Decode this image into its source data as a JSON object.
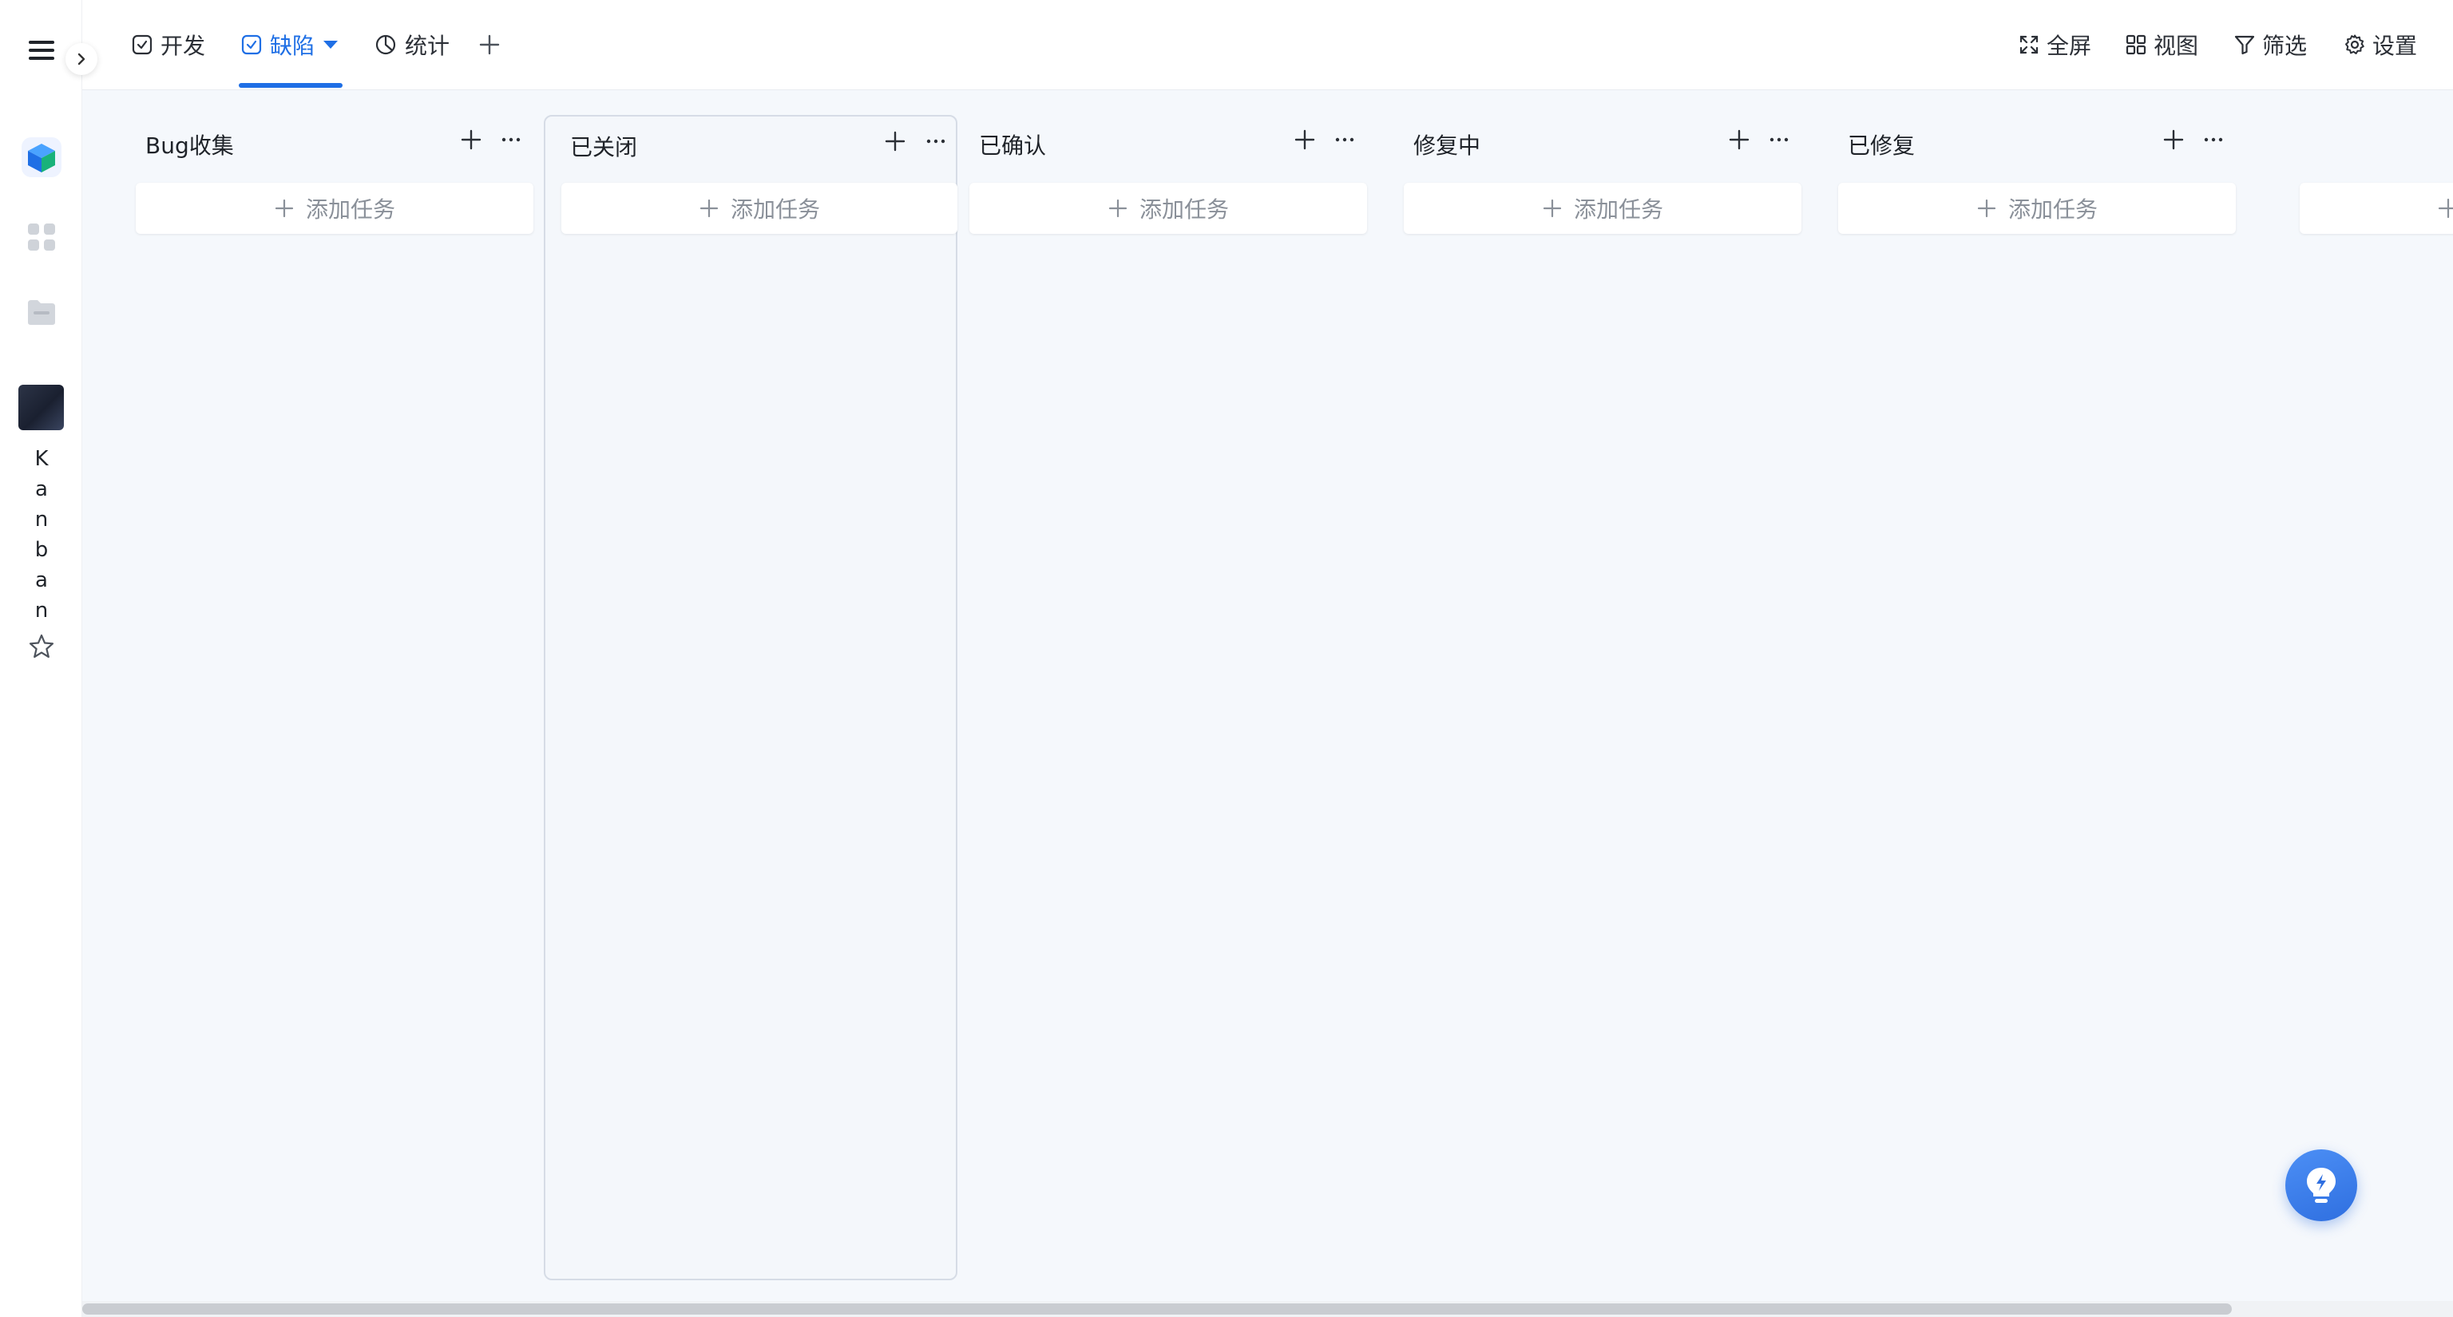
{
  "rail": {
    "vertical_label": [
      "K",
      "a",
      "n",
      "b",
      "a",
      "n"
    ]
  },
  "topbar": {
    "tabs": [
      {
        "label": "开发",
        "icon": "check-square-icon"
      },
      {
        "label": "缺陷",
        "icon": "check-square-icon",
        "active": true
      },
      {
        "label": "统计",
        "icon": "pie-chart-icon"
      }
    ],
    "tools": [
      {
        "label": "全屏",
        "icon": "fullscreen-icon"
      },
      {
        "label": "视图",
        "icon": "grid-icon"
      },
      {
        "label": "筛选",
        "icon": "filter-icon"
      },
      {
        "label": "设置",
        "icon": "gear-icon"
      }
    ]
  },
  "board": {
    "add_task_label": "添加任务",
    "columns": [
      {
        "title": "Bug收集"
      },
      {
        "title": "已关闭"
      },
      {
        "title": "已确认"
      },
      {
        "title": "修复中"
      },
      {
        "title": "已修复"
      }
    ]
  },
  "colors": {
    "accent": "#1f6fe5",
    "board_bg": "#f5f8fc"
  }
}
